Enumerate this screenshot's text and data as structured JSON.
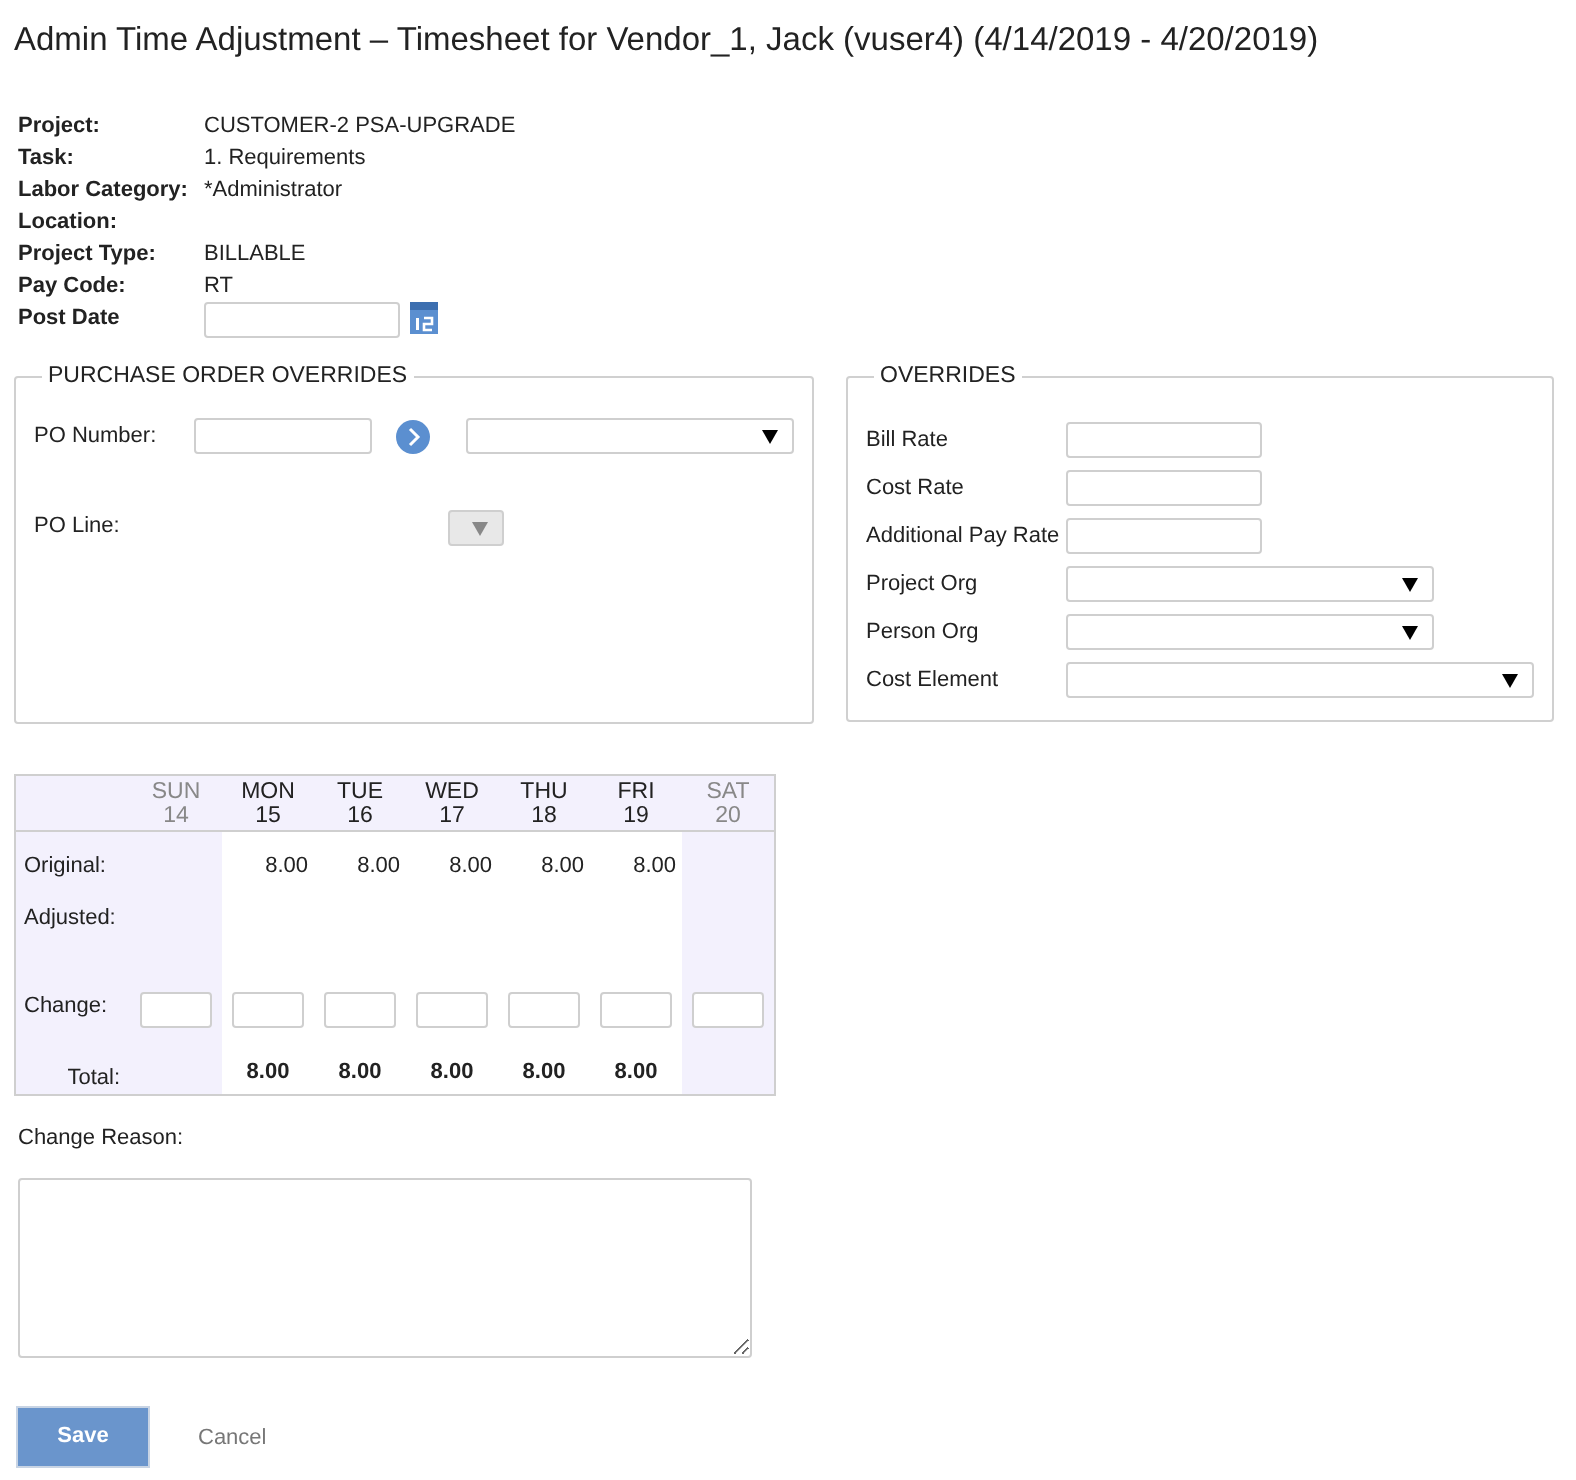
{
  "title": "Admin Time Adjustment – Timesheet for Vendor_1, Jack (vuser4) (4/14/2019 - 4/20/2019)",
  "details": [
    {
      "label": "Project:",
      "value": "CUSTOMER-2 PSA-UPGRADE"
    },
    {
      "label": "Task:",
      "value": "1. Requirements"
    },
    {
      "label": "Labor Category:",
      "value": "*Administrator"
    },
    {
      "label": "Location:"
    },
    {
      "label": "Project Type:",
      "value": "BILLABLE"
    },
    {
      "label": "Pay Code:",
      "value": "RT"
    }
  ],
  "post_date": {
    "label": "Post Date"
  },
  "po_overrides": {
    "legend": "PURCHASE ORDER OVERRIDES",
    "po_number_label": "PO Number:",
    "po_line_label": "PO Line:",
    "po_line_disabled": true
  },
  "overrides": {
    "legend": "OVERRIDES",
    "fields": [
      {
        "label": "Bill Rate",
        "kind": "input"
      },
      {
        "label": "Cost Rate",
        "kind": "input"
      },
      {
        "label": "Additional Pay Rate",
        "kind": "input"
      },
      {
        "label": "Project Org",
        "kind": "select"
      },
      {
        "label": "Person Org",
        "kind": "select"
      },
      {
        "label": "Cost Element",
        "kind": "wide_select"
      }
    ]
  },
  "timesheet": {
    "row_labels": {
      "original": "Original:",
      "adjusted": "Adjusted:",
      "change": "Change:",
      "total": "Total:"
    },
    "days": [
      {
        "day": "SUN",
        "date": "14",
        "weekend": true
      },
      {
        "day": "MON",
        "date": "15",
        "weekend": false,
        "original": "8.00",
        "total": "8.00"
      },
      {
        "day": "TUE",
        "date": "16",
        "weekend": false,
        "original": "8.00",
        "total": "8.00"
      },
      {
        "day": "WED",
        "date": "17",
        "weekend": false,
        "original": "8.00",
        "total": "8.00"
      },
      {
        "day": "THU",
        "date": "18",
        "weekend": false,
        "original": "8.00",
        "total": "8.00"
      },
      {
        "day": "FRI",
        "date": "19",
        "weekend": false,
        "original": "8.00",
        "total": "8.00"
      },
      {
        "day": "SAT",
        "date": "20",
        "weekend": true
      }
    ]
  },
  "change_reason": {
    "label": "Change Reason:"
  },
  "buttons": {
    "save": "Save",
    "cancel": "Cancel"
  }
}
